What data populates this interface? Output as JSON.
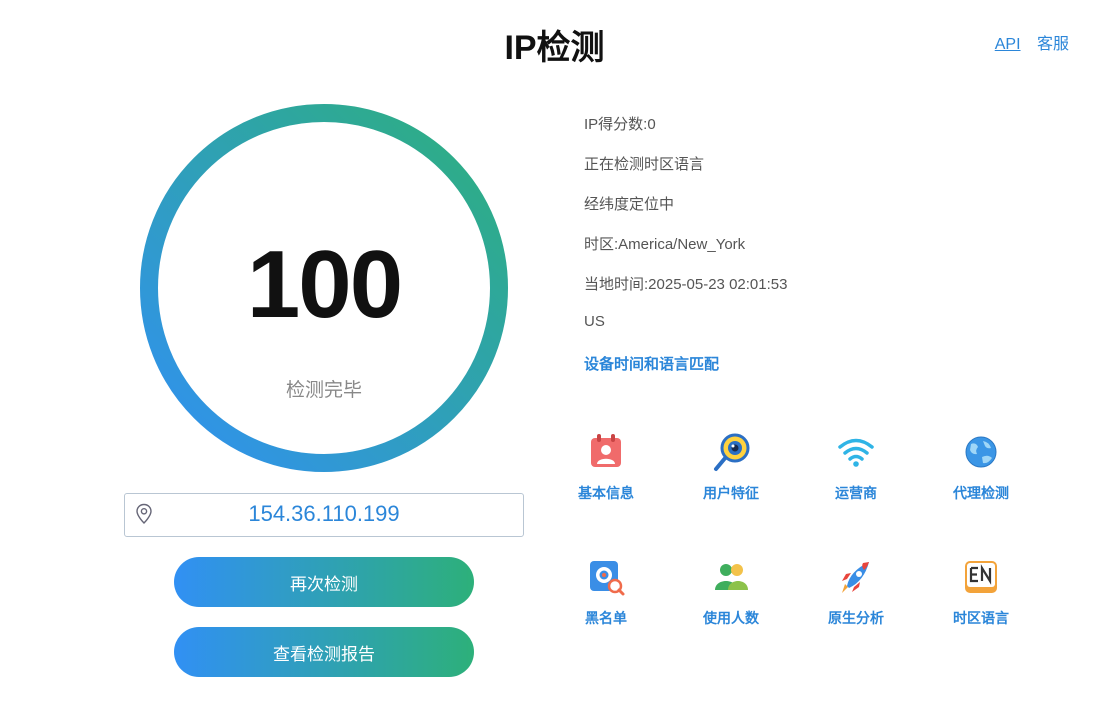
{
  "header": {
    "title": "IP检测",
    "links": [
      "API",
      "客服"
    ]
  },
  "gauge": {
    "score": "100",
    "max": 100,
    "status_text": "检测完毕"
  },
  "ip_field": {
    "value": "154.36.110.199",
    "icon": "location-pin-icon"
  },
  "buttons": {
    "retest": "再次检测",
    "report": "查看检测报告"
  },
  "info_lines": [
    "IP得分数:0",
    "正在检测时区语言",
    "经纬度定位中",
    "时区:America/New_York",
    "当地时间:2025-05-23 02:01:53",
    "US",
    "设备时间和语言匹配"
  ],
  "tools": [
    {
      "label": "基本信息",
      "icon": "id-card-icon"
    },
    {
      "label": "用户特征",
      "icon": "magnifier-eye-icon"
    },
    {
      "label": "运营商",
      "icon": "wifi-icon"
    },
    {
      "label": "代理检测",
      "icon": "globe-icon"
    },
    {
      "label": "黑名单",
      "icon": "blacklist-search-icon"
    },
    {
      "label": "使用人数",
      "icon": "users-icon"
    },
    {
      "label": "原生分析",
      "icon": "rocket-icon"
    },
    {
      "label": "时区语言",
      "icon": "en-language-icon"
    }
  ],
  "colors": {
    "accent_blue": "#2b86d9",
    "gradient_start": "#3190f4",
    "gradient_end": "#2db07a"
  }
}
